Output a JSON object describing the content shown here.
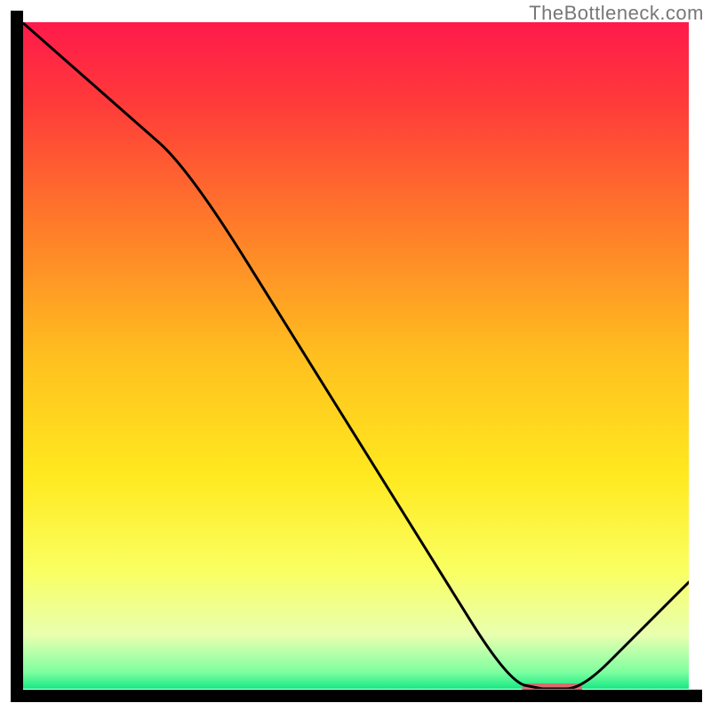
{
  "watermark": "TheBottleneck.com",
  "colors": {
    "black": "#000000",
    "marker": "#d66e6e",
    "gradient": [
      {
        "offset": 0.0,
        "color": "#ff1a4b"
      },
      {
        "offset": 0.12,
        "color": "#ff3a3a"
      },
      {
        "offset": 0.3,
        "color": "#ff7a2a"
      },
      {
        "offset": 0.5,
        "color": "#ffbf1f"
      },
      {
        "offset": 0.68,
        "color": "#ffe91f"
      },
      {
        "offset": 0.82,
        "color": "#faff60"
      },
      {
        "offset": 0.92,
        "color": "#e8ffb0"
      },
      {
        "offset": 0.975,
        "color": "#7effa0"
      },
      {
        "offset": 1.0,
        "color": "#18e884"
      }
    ]
  },
  "chart_data": {
    "type": "line",
    "title": "",
    "xlabel": "",
    "ylabel": "",
    "xlim": [
      0,
      100
    ],
    "ylim": [
      0,
      100
    ],
    "x": [
      0,
      25,
      73,
      78,
      84,
      100
    ],
    "values": [
      100,
      78,
      1,
      0,
      0,
      16
    ]
  },
  "marker": {
    "x_start": 75,
    "x_end": 84,
    "y": 0,
    "thickness_pct": 1.6
  }
}
